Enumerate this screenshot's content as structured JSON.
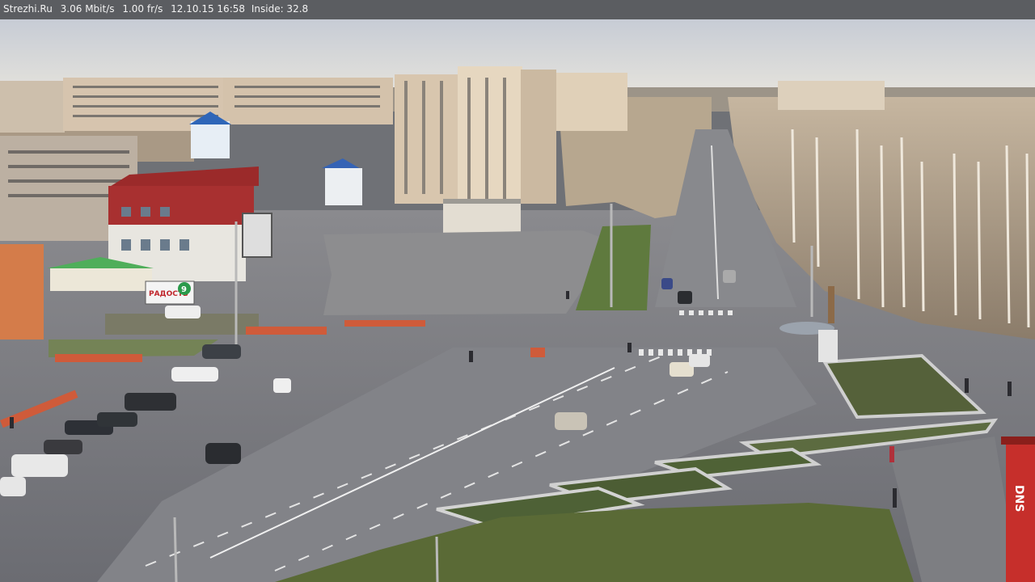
{
  "status_bar": {
    "site": "Strezhi.Ru",
    "bitrate": "3.06 Mbit/s",
    "framerate": "1.00 fr/s",
    "datetime": "12.10.15 16:58",
    "temperature": "Inside: 32.8"
  },
  "scene": {
    "store_sign": "РАДОСТЬ",
    "store_sign_digit": "9",
    "dns_sign": "DNS"
  }
}
